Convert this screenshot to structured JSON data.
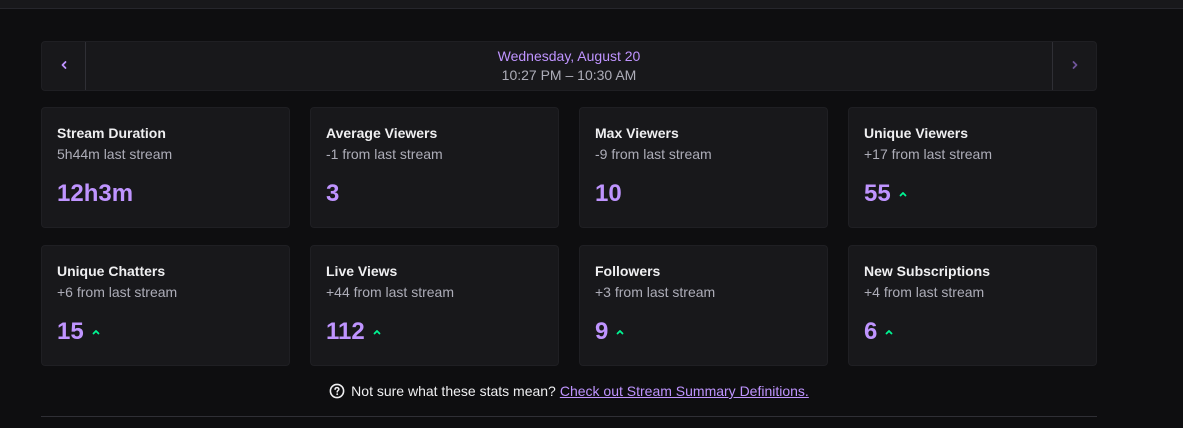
{
  "header": {
    "date": "Wednesday, August 20",
    "time_range": "10:27 PM – 10:30 AM"
  },
  "stats": [
    {
      "title": "Stream Duration",
      "sub": "5h44m last stream",
      "value": "12h3m",
      "trend": "none"
    },
    {
      "title": "Average Viewers",
      "sub": "-1 from last stream",
      "value": "3",
      "trend": "none"
    },
    {
      "title": "Max Viewers",
      "sub": "-9 from last stream",
      "value": "10",
      "trend": "none"
    },
    {
      "title": "Unique Viewers",
      "sub": "+17 from last stream",
      "value": "55",
      "trend": "up"
    },
    {
      "title": "Unique Chatters",
      "sub": "+6 from last stream",
      "value": "15",
      "trend": "up"
    },
    {
      "title": "Live Views",
      "sub": "+44 from last stream",
      "value": "112",
      "trend": "up"
    },
    {
      "title": "Followers",
      "sub": "+3 from last stream",
      "value": "9",
      "trend": "up"
    },
    {
      "title": "New Subscriptions",
      "sub": "+4 from last stream",
      "value": "6",
      "trend": "up"
    }
  ],
  "help": {
    "text": "Not sure what these stats mean?",
    "link": "Check out Stream Summary Definitions."
  },
  "icons": {
    "prev": "chevron-left-icon",
    "next": "chevron-right-icon",
    "trend_up": "chevron-up-icon",
    "help": "question-circle-icon"
  },
  "colors": {
    "accent": "#bf94ff",
    "trend_up": "#00f593",
    "background": "#0e0e10",
    "card": "#18181b"
  }
}
